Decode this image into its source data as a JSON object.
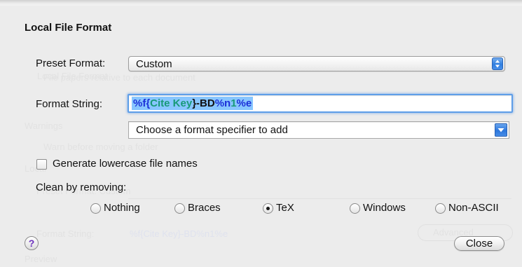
{
  "sheet": {
    "title": "Local File Format"
  },
  "preset": {
    "label": "Preset Format:",
    "value": "Custom",
    "stepper_icon": "up-down-arrows"
  },
  "format_string": {
    "label": "Format String:",
    "value": "%f{Cite Key}-BD%n1%e",
    "tokens": [
      "%f{",
      "Cite Key",
      "}-BD",
      "%n",
      "1",
      "%e"
    ]
  },
  "specifier": {
    "value": "Choose a format specifier to add",
    "arrow_icon": "down-arrow"
  },
  "lowercase": {
    "label": "Generate lowercase file names",
    "checked": false
  },
  "clean": {
    "label": "Clean by removing:",
    "options": [
      "Nothing",
      "Braces",
      "TeX",
      "Windows",
      "Non-ASCII"
    ],
    "selected": "TeX"
  },
  "buttons": {
    "help": "?",
    "close": "Close"
  },
  "colors": {
    "selection": "#88c6ff",
    "focus_ring": "#5e9ee8",
    "token_specifier": "#1c31d8",
    "token_field": "#189a78",
    "help_mark": "#6a2fbd"
  }
}
